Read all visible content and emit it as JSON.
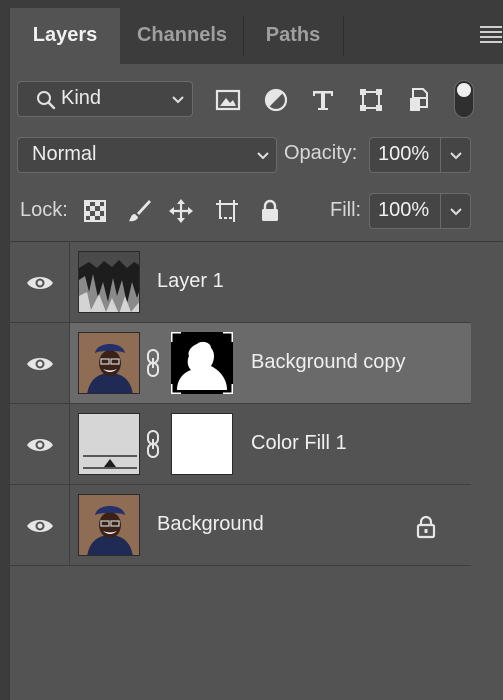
{
  "tabs": [
    {
      "label": "Layers",
      "active": true
    },
    {
      "label": "Channels",
      "active": false
    },
    {
      "label": "Paths",
      "active": false
    }
  ],
  "filter": {
    "kind_label": "Kind",
    "icons": [
      "image-filter-icon",
      "adjustment-filter-icon",
      "type-filter-icon",
      "shape-filter-icon",
      "smart-object-filter-icon"
    ]
  },
  "blend": {
    "mode": "Normal",
    "opacity_label": "Opacity:",
    "opacity_value": "100%"
  },
  "lock": {
    "label": "Lock:",
    "icons": [
      "lock-transparent-pixels-icon",
      "lock-image-pixels-icon",
      "lock-position-icon",
      "lock-artboard-icon",
      "lock-all-icon"
    ],
    "fill_label": "Fill:",
    "fill_value": "100%"
  },
  "layers": [
    {
      "name": "Layer 1",
      "visible": true,
      "selected": false,
      "thumbnail": "dark-texture",
      "has_mask": false,
      "locked": false
    },
    {
      "name": "Background copy",
      "visible": true,
      "selected": true,
      "thumbnail": "portrait",
      "has_mask": true,
      "mask": "silhouette",
      "locked": false
    },
    {
      "name": "Color Fill 1",
      "visible": true,
      "selected": false,
      "thumbnail": "color-fill",
      "has_mask": true,
      "mask": "white",
      "locked": false
    },
    {
      "name": "Background",
      "visible": true,
      "selected": false,
      "thumbnail": "portrait",
      "has_mask": false,
      "locked": true
    }
  ],
  "colors": {
    "panel_bg": "#535353",
    "tab_bar_bg": "#3c3c3c",
    "selected_row": "#6a6a6a",
    "text": "#f0f0f0"
  }
}
